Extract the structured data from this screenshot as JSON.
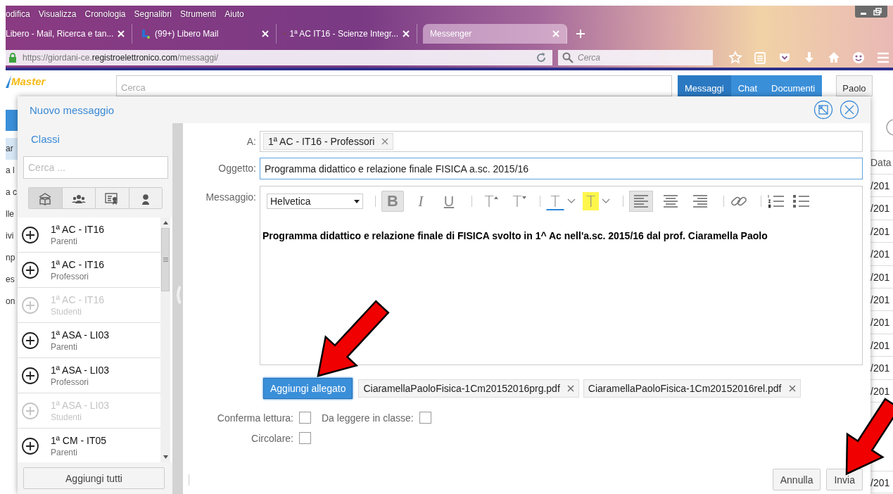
{
  "browser": {
    "menu": [
      "odifica",
      "Visualizza",
      "Cronologia",
      "Segnalibri",
      "Strumenti",
      "Aiuto"
    ],
    "tabs": [
      {
        "label": "Libero - Mail, Ricerca e tan...",
        "selected": false
      },
      {
        "label": "(99+) Libero Mail",
        "selected": false
      },
      {
        "label": "1ª AC IT16 - Scienze Integr...",
        "selected": false
      },
      {
        "label": "Messenger",
        "selected": true
      }
    ],
    "url": "https://giordani-ce.**registroelettronico.com**/messaggi/",
    "search_placeholder": "Cerca"
  },
  "page": {
    "logo": "Master",
    "search_placeholder": "Cerca",
    "nav": [
      {
        "label": "Messaggi",
        "selected": true
      },
      {
        "label": "Chat",
        "selected": false
      },
      {
        "label": "Documenti",
        "selected": false
      }
    ],
    "user": "Paolo",
    "sidebar_items": [
      {
        "label": "ar",
        "selected": true
      },
      {
        "label": "a l",
        "selected": false
      },
      {
        "label": "a c",
        "selected": false
      },
      {
        "label": "lle",
        "selected": false
      },
      {
        "label": "ivi",
        "selected": false
      },
      {
        "label": "np",
        "selected": false
      },
      {
        "label": "es",
        "selected": false
      },
      {
        "label": "on",
        "selected": false
      }
    ],
    "date_column": {
      "header": "Data",
      "cells": [
        "/201",
        "/201",
        "/201",
        "/201",
        "/201",
        "/201",
        "/201",
        "/201",
        "/201",
        "/201",
        "/201"
      ]
    }
  },
  "dialog": {
    "title": "Nuovo messaggio",
    "classes": {
      "title": "Classi",
      "search_placeholder": "Cerca ...",
      "filters": [
        {
          "selected": true
        },
        {
          "selected": false
        },
        {
          "selected": false
        },
        {
          "selected": false
        }
      ],
      "items": [
        {
          "title": "1ª AC - IT16",
          "subtitle": "Parenti",
          "disabled": false
        },
        {
          "title": "1ª AC - IT16",
          "subtitle": "Professori",
          "disabled": false
        },
        {
          "title": "1ª AC - IT16",
          "subtitle": "Studenti",
          "disabled": true
        },
        {
          "title": "1ª ASA - LI03",
          "subtitle": "Parenti",
          "disabled": false
        },
        {
          "title": "1ª ASA - LI03",
          "subtitle": "Professori",
          "disabled": false
        },
        {
          "title": "1ª ASA - LI03",
          "subtitle": "Studenti",
          "disabled": true
        },
        {
          "title": "1ª CM - IT05",
          "subtitle": "Parenti",
          "disabled": false
        }
      ],
      "add_all": "Aggiungi tutti"
    },
    "to_label": "A:",
    "recipients": [
      "1ª AC - IT16 - Professori"
    ],
    "subject_label": "Oggetto:",
    "subject": "Programma didattico e relazione finale FISICA a.sc. 2015/16",
    "message_label": "Messaggio:",
    "toolbar": {
      "font": "Helvetica",
      "format_buttons": [
        {
          "label": "B",
          "active": true
        },
        {
          "label": "I",
          "active": false
        },
        {
          "label": "U",
          "active": false
        },
        {
          "label": "T",
          "active": false
        },
        {
          "label": "T",
          "active": false
        },
        {
          "label": "T",
          "active": false
        },
        {
          "label": "T",
          "active": false
        }
      ],
      "align_buttons": [
        {
          "active": true
        },
        {
          "active": false
        },
        {
          "active": false
        }
      ]
    },
    "body": "Programma didattico e relazione finale di FISICA svolto in 1^ Ac nell'a.sc. 2015/16 dal prof. Ciaramella Paolo",
    "attach_button": "Aggiungi allegato",
    "attachments": [
      "CiaramellaPaoloFisica-1Cm20152016prg.pdf",
      "CiaramellaPaoloFisica-1Cm20152016rel.pdf"
    ],
    "options": [
      {
        "label": "Conferma lettura:",
        "checked": false
      },
      {
        "label": "Da leggere in classe:",
        "checked": false
      },
      {
        "label": "Circolare:",
        "checked": false
      }
    ],
    "cancel": "Annulla",
    "send": "Invia"
  }
}
